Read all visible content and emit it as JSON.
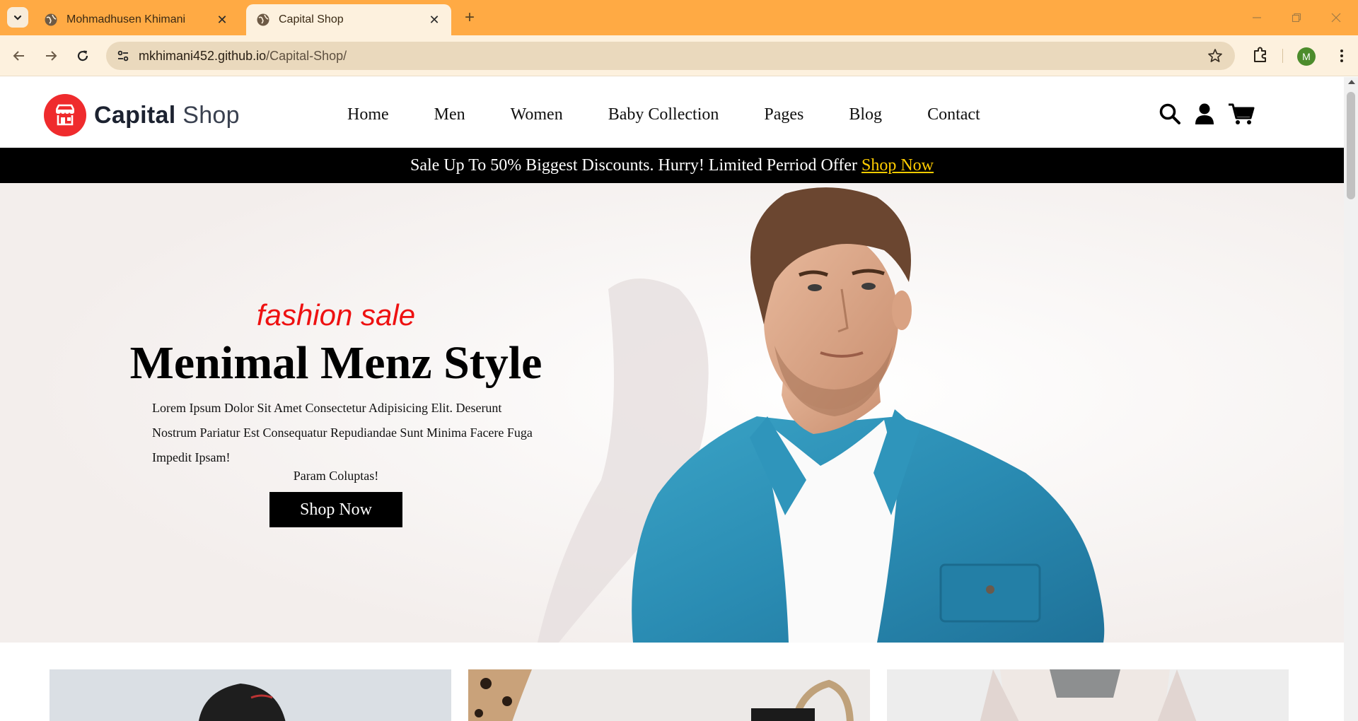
{
  "browser": {
    "tabs": [
      {
        "title": "Mohmadhusen Khimani",
        "active": false
      },
      {
        "title": "Capital Shop",
        "active": true
      }
    ],
    "url_host": "mkhimani452.github.io",
    "url_path": "/Capital-Shop/",
    "profile_initial": "M",
    "accent_color": "#ffaa44"
  },
  "site": {
    "logo_bold": "Capital",
    "logo_light": "Shop",
    "nav": [
      "Home",
      "Men",
      "Women",
      "Baby Collection",
      "Pages",
      "Blog",
      "Contact"
    ],
    "icons": [
      "search-icon",
      "user-icon",
      "cart-icon"
    ],
    "brand_color": "#ef2b2d"
  },
  "promo": {
    "text": "Sale Up To 50% Biggest Discounts. Hurry! Limited Perriod Offer",
    "link": "Shop Now"
  },
  "hero": {
    "eyebrow": "fashion sale",
    "title": "Menimal Menz Style",
    "description": "Lorem Ipsum Dolor Sit Amet Consectetur Adipisicing Elit. Deserunt Nostrum Pariatur Est Consequatur Repudiandae Sunt Minima Facere Fuga Impedit Ipsam!",
    "description_tail": "Param Coluptas!",
    "button": "Shop Now"
  }
}
